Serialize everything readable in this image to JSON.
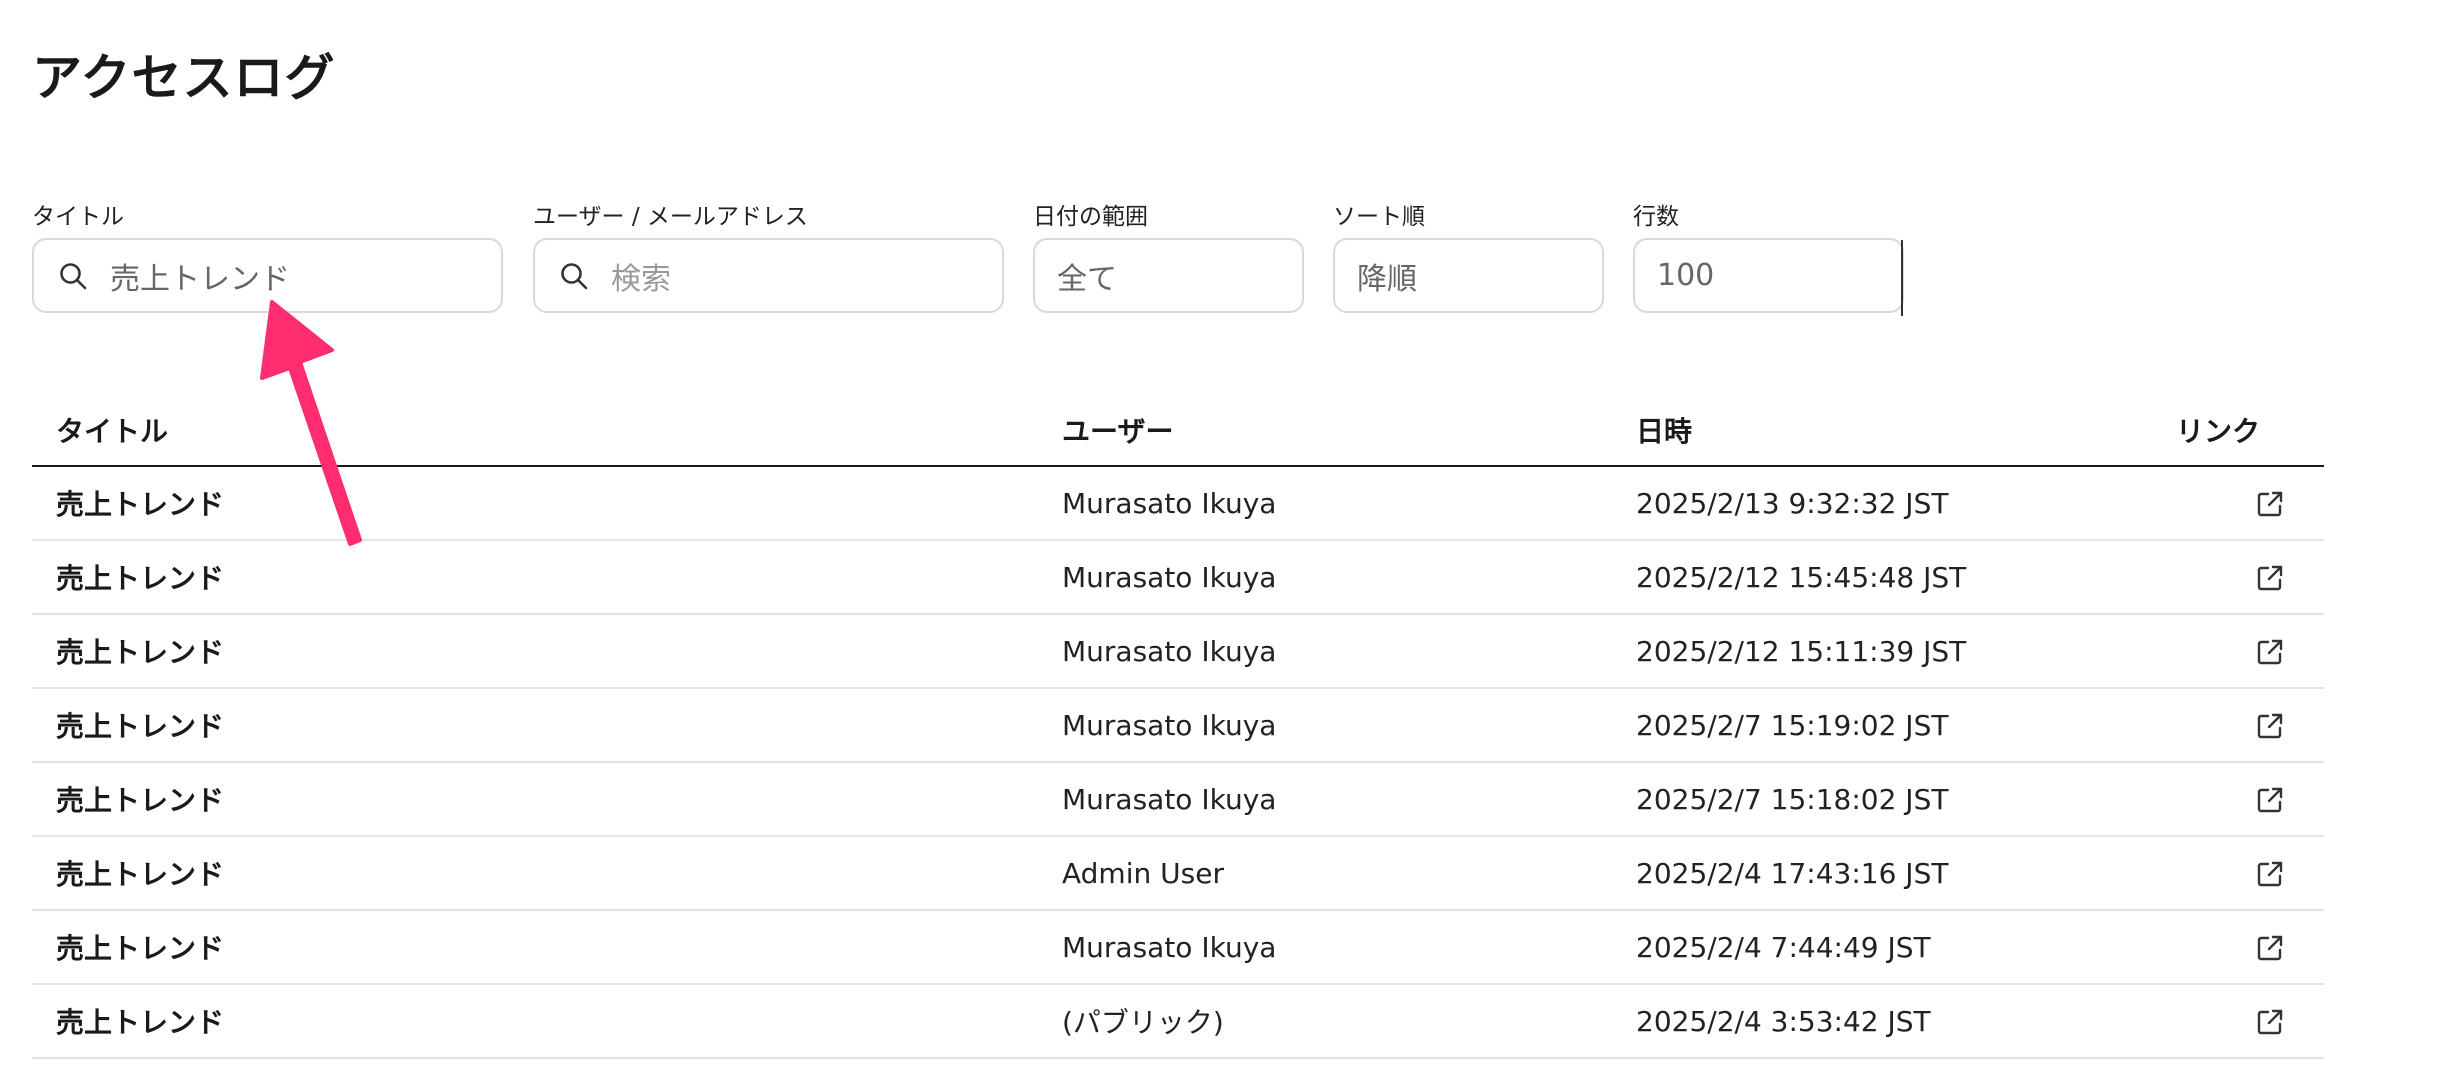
{
  "page": {
    "title": "アクセスログ"
  },
  "filters": {
    "title": {
      "label": "タイトル",
      "value": "売上トレンド",
      "icon": "search-icon"
    },
    "user": {
      "label": "ユーザー / メールアドレス",
      "placeholder": "検索",
      "icon": "search-icon"
    },
    "date_range": {
      "label": "日付の範囲",
      "value": "全て"
    },
    "sort": {
      "label": "ソート順",
      "value": "降順"
    },
    "rows": {
      "label": "行数",
      "value": "100"
    }
  },
  "table": {
    "headers": {
      "title": "タイトル",
      "user": "ユーザー",
      "datetime": "日時",
      "link": "リンク"
    },
    "rows": [
      {
        "title": "売上トレンド",
        "user": "Murasato Ikuya",
        "datetime": "2025/2/13 9:32:32 JST"
      },
      {
        "title": "売上トレンド",
        "user": "Murasato Ikuya",
        "datetime": "2025/2/12 15:45:48 JST"
      },
      {
        "title": "売上トレンド",
        "user": "Murasato Ikuya",
        "datetime": "2025/2/12 15:11:39 JST"
      },
      {
        "title": "売上トレンド",
        "user": "Murasato Ikuya",
        "datetime": "2025/2/7 15:19:02 JST"
      },
      {
        "title": "売上トレンド",
        "user": "Murasato Ikuya",
        "datetime": "2025/2/7 15:18:02 JST"
      },
      {
        "title": "売上トレンド",
        "user": "Admin User",
        "datetime": "2025/2/4 17:43:16 JST"
      },
      {
        "title": "売上トレンド",
        "user": "Murasato Ikuya",
        "datetime": "2025/2/4 7:44:49 JST"
      },
      {
        "title": "売上トレンド",
        "user": "(パブリック)",
        "datetime": "2025/2/4 3:53:42 JST"
      }
    ],
    "link_icon": "external-link-icon"
  },
  "annotation": {
    "arrow_color": "#ff2d6f"
  }
}
